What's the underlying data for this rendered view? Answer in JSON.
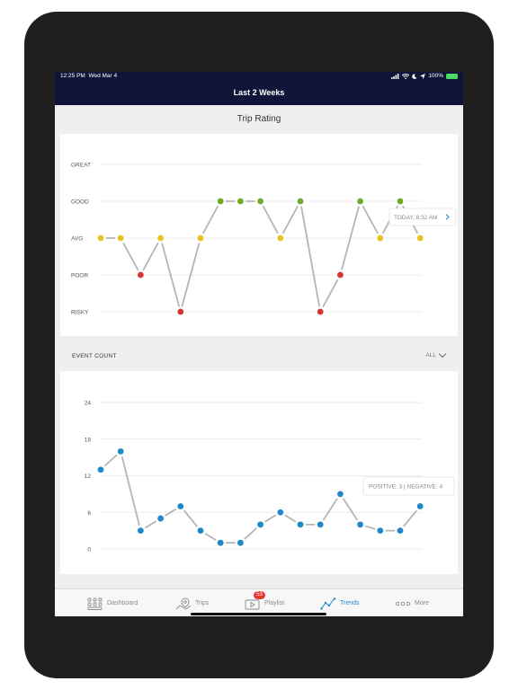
{
  "status_bar": {
    "time": "12:25 PM",
    "date": "Wed Mar 4",
    "battery": "100%"
  },
  "nav": {
    "title": "Last 2 Weeks"
  },
  "trip_rating": {
    "title": "Trip Rating"
  },
  "event_count": {
    "label": "EVENT COUNT",
    "filter": "ALL"
  },
  "colors": {
    "good": "#6aab2e",
    "avg": "#e8c31e",
    "poor": "#d63333",
    "event": "#1e88c8",
    "line": "#b5b5b5",
    "nav": "#0e1538"
  },
  "chart_data": [
    {
      "type": "line",
      "title": "Trip Rating",
      "categories": [
        "GREAT",
        "GOOD",
        "AVG",
        "POOR",
        "RISKY"
      ],
      "x": [
        1,
        2,
        3,
        4,
        5,
        6,
        7,
        8,
        9,
        10,
        11,
        12,
        13,
        14,
        15,
        16,
        17
      ],
      "values": [
        "AVG",
        "AVG",
        "POOR",
        "AVG",
        "RISKY",
        "AVG",
        "GOOD",
        "GOOD",
        "GOOD",
        "AVG",
        "GOOD",
        "RISKY",
        "POOR",
        "GOOD",
        "AVG",
        "GOOD",
        "AVG"
      ],
      "annotation": "TODAY, 8:32 AM",
      "grid": true
    },
    {
      "type": "line",
      "title": "EVENT COUNT",
      "x": [
        1,
        2,
        3,
        4,
        5,
        6,
        7,
        8,
        9,
        10,
        11,
        12,
        13,
        14,
        15,
        16,
        17
      ],
      "values": [
        13,
        16,
        3,
        5,
        7,
        3,
        1,
        1,
        4,
        6,
        4,
        4,
        9,
        4,
        3,
        3,
        7
      ],
      "yticks": [
        0,
        6,
        12,
        18,
        24
      ],
      "ylim": [
        0,
        24
      ],
      "annotation": "POSITIVE: 3 | NEGATIVE: 4",
      "grid": true
    }
  ],
  "tabs": [
    {
      "label": "Dashboard",
      "icon": "dashboard-icon"
    },
    {
      "label": "Trips",
      "icon": "map-pin-icon"
    },
    {
      "label": "Playlist",
      "icon": "playlist-icon",
      "badge": "53"
    },
    {
      "label": "Trends",
      "icon": "trends-icon",
      "active": true
    },
    {
      "label": "More",
      "icon": "more-icon"
    }
  ]
}
